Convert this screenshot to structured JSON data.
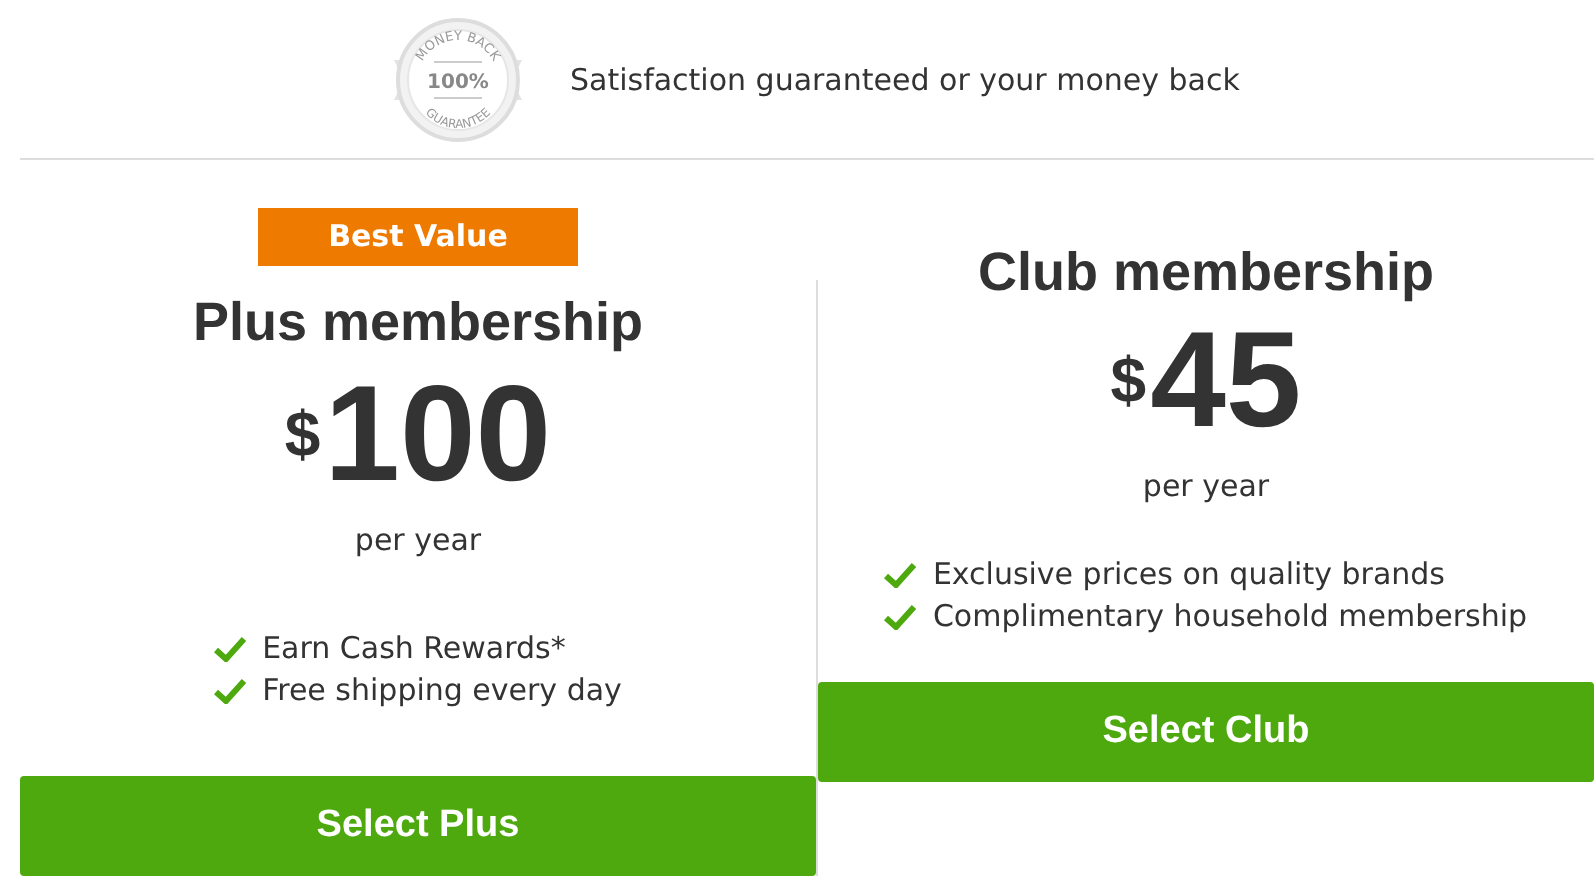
{
  "guarantee": {
    "seal": {
      "top": "MONEY BACK",
      "middle": "100%",
      "bottom": "GUARANTEE"
    },
    "text": "Satisfaction guaranteed or your money back"
  },
  "plans": [
    {
      "badge": "Best Value",
      "title": "Plus membership",
      "currency": "$",
      "price": "100",
      "period": "per year",
      "features": [
        "Earn Cash Rewards*",
        "Free shipping every day"
      ],
      "button": "Select Plus"
    },
    {
      "title": "Club membership",
      "currency": "$",
      "price": "45",
      "period": "per year",
      "features": [
        "Exclusive prices on quality brands",
        "Complimentary household membership"
      ],
      "button": "Select Club"
    }
  ]
}
